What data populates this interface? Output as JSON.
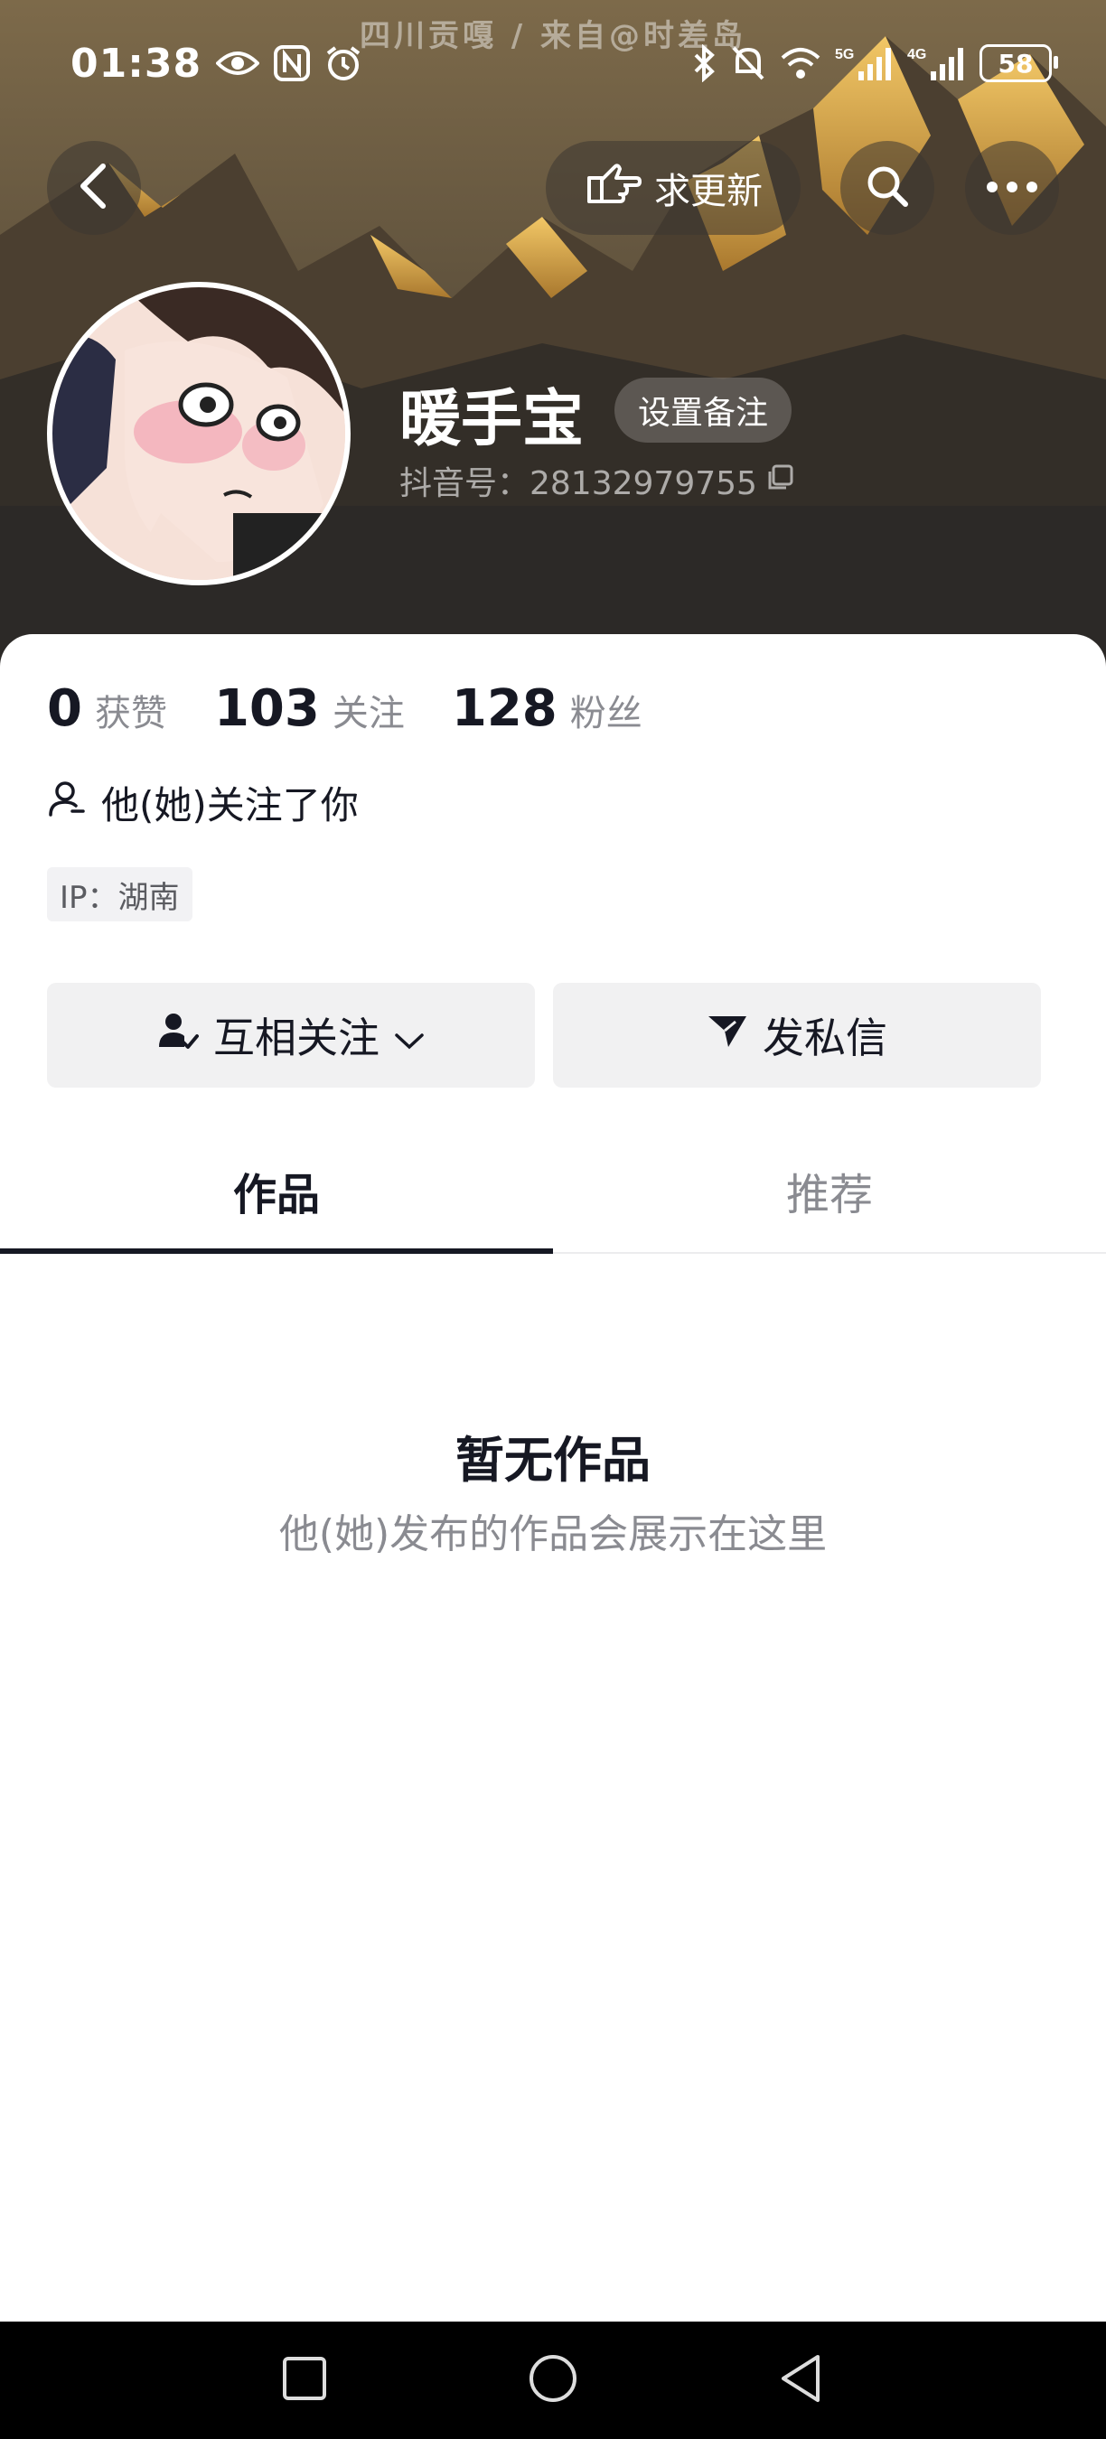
{
  "status_bar": {
    "time": "01:38",
    "battery": "58",
    "network_5g": "5G",
    "network_4g": "4G"
  },
  "watermark": "四川贡嘎 / 来自@时差岛",
  "header": {
    "update_label": "求更新"
  },
  "profile": {
    "nickname": "暖手宝",
    "remark_label": "设置备注",
    "douyin_id": "抖音号：28132979755"
  },
  "stats": [
    {
      "value": "0",
      "label": "获赞"
    },
    {
      "value": "103",
      "label": "关注"
    },
    {
      "value": "128",
      "label": "粉丝"
    }
  ],
  "follows_you": "他(她)关注了你",
  "ip_location": "IP：湖南",
  "actions": {
    "mutual_follow": "互相关注",
    "message": "发私信"
  },
  "tabs": [
    {
      "label": "作品",
      "active": true
    },
    {
      "label": "推荐",
      "active": false
    }
  ],
  "empty_state": {
    "title": "暂无作品",
    "subtitle": "他(她)发布的作品会展示在这里"
  },
  "colors": {
    "text_primary": "#161823",
    "text_secondary": "#8a8b91",
    "button_bg": "#f1f1f2"
  }
}
